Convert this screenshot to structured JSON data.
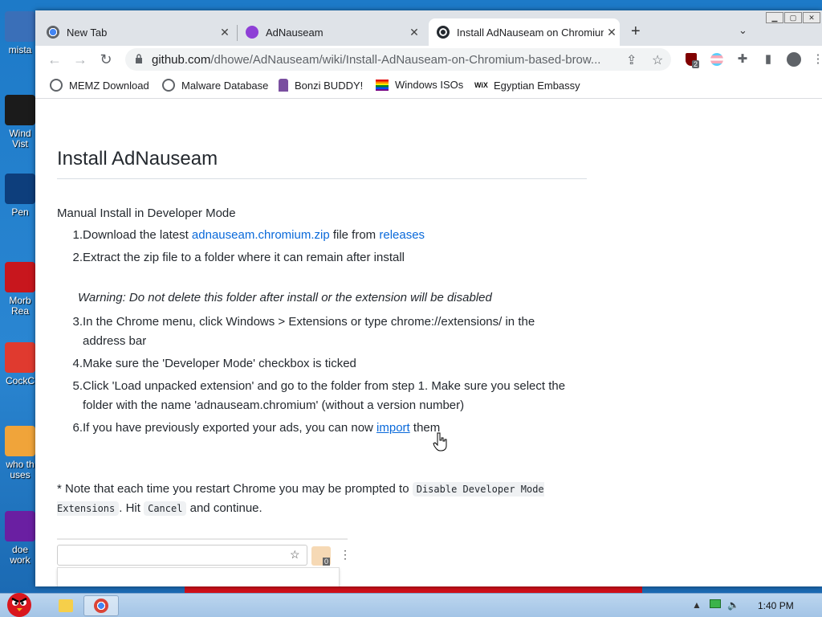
{
  "desktop": {
    "icons": [
      {
        "label": "mista",
        "color": "#3a6fb8"
      },
      {
        "label": "Wind\nVist",
        "color": "#1b1b1b"
      },
      {
        "label": "Pen",
        "color": "#0d3e7c"
      },
      {
        "label": "Morb\nRea",
        "color": "#c8161d"
      },
      {
        "label": "CockC",
        "color": "#e03a2f"
      },
      {
        "label": "who th\nuses",
        "color": "#f0a43a"
      },
      {
        "label": "doe\nwork",
        "color": "#6a1fa2"
      }
    ]
  },
  "browser": {
    "tabs": [
      {
        "title": "New Tab",
        "icon": "chrome-icon"
      },
      {
        "title": "AdNauseam",
        "icon": "adnauseam-icon"
      },
      {
        "title": "Install AdNauseam on Chromium-based browsers",
        "icon": "github-icon"
      }
    ],
    "new_tab_label": "+",
    "tab_list_label": "⌄",
    "url_host": "github.com",
    "url_path": "/dhowe/AdNauseam/wiki/Install-AdNauseam-on-Chromium-based-brow...",
    "bookmarks": [
      {
        "label": "MEMZ Download",
        "icon": "globe-icon"
      },
      {
        "label": "Malware Database",
        "icon": "globe-icon"
      },
      {
        "label": "Bonzi BUDDY!",
        "icon": "bonzi-icon"
      },
      {
        "label": "Windows ISOs",
        "icon": "rainbow-flag-icon"
      },
      {
        "label": "Egyptian Embassy",
        "icon": "wix-icon"
      }
    ],
    "ublock_badge": "2"
  },
  "page": {
    "title": "Install AdNauseam",
    "section": "Manual Install in Developer Mode",
    "steps": [
      {
        "n": "1.",
        "pre": "Download the latest ",
        "link1": "adnauseam.chromium.zip",
        "mid": " file from ",
        "link2": "releases"
      },
      {
        "n": "2.",
        "text": "Extract the zip file to a folder where it can remain after install"
      },
      {
        "n": "3.",
        "text": "In the Chrome menu, click Windows > Extensions or type chrome://extensions/ in the address bar"
      },
      {
        "n": "4.",
        "text": "Make sure the 'Developer Mode' checkbox is ticked"
      },
      {
        "n": "5.",
        "text": "Click 'Load unpacked extension' and go to the folder from step 1. Make sure you select the folder with the name 'adnauseam.chromium' (without a version number)"
      },
      {
        "n": "6.",
        "pre": "If you have previously exported your ads, you can now ",
        "link": "import",
        "post": " them"
      }
    ],
    "warning": "Warning: Do not delete this folder after install or the extension will be disabled",
    "note_pre": "* Note that each time you restart Chrome you may be prompted to ",
    "note_code1": "Disable Developer Mode Extensions",
    "note_mid": ". Hit ",
    "note_code2": "Cancel",
    "note_post": " and continue.",
    "screenshot_badge": "0"
  },
  "taskbar": {
    "clock": "1:40 PM"
  },
  "colors": {
    "link": "#0969da",
    "tabbar": "#dfe3e8",
    "desktop": "#1e6fb5"
  }
}
